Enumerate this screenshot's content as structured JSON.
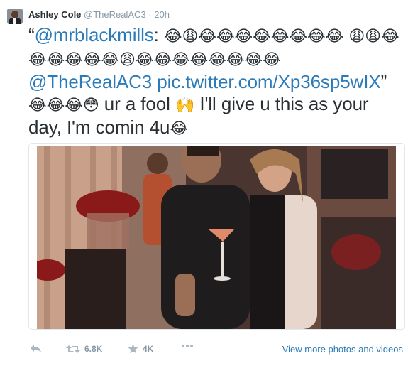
{
  "tweet": {
    "fullname": "Ashley Cole",
    "username": "@TheRealAC3",
    "separator": "·",
    "time": "20h",
    "quote_open": "“",
    "mention": "@mrblackmills",
    "colon": ":",
    "emoji_line1": "😂😩😂😂😂😂😂😂😂😂",
    "emoji_line2": "😩😩😂😂😂😂😂😂😩😂😂😂😂😂😂😂😂",
    "mention2": "@TheRealAC3",
    "pic_link": "pic.twitter.com/Xp36sp5wIX",
    "quote_close": "”",
    "emoji_line3": "😂😂😂😳",
    "text_part1": " ur a fool ",
    "hands_emoji": "🙌",
    "text_part2": " I'll give u this as your day, I'm comin 4u",
    "end_emoji": "😂"
  },
  "actions": {
    "retweet_count": "6.8K",
    "favorite_count": "4K",
    "view_more": "View more photos and videos"
  },
  "icons": {
    "reply": "reply-icon",
    "retweet": "retweet-icon",
    "favorite": "star-icon",
    "more": "more-icon"
  },
  "colors": {
    "link": "#2b7bb9",
    "muted": "#8899a6",
    "text": "#292f33",
    "icon": "#aab8c2"
  }
}
